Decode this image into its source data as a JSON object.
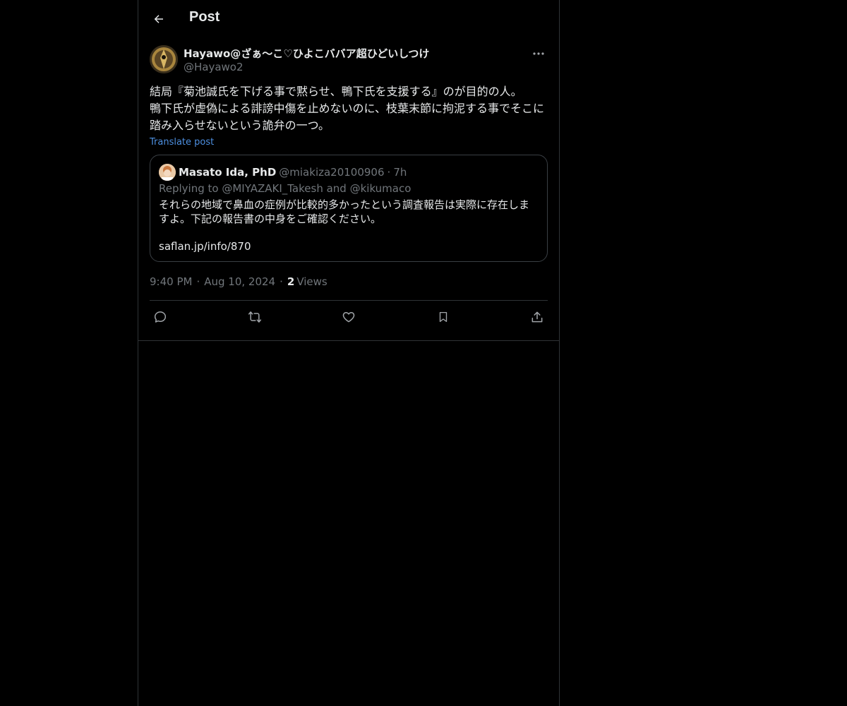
{
  "header": {
    "title": "Post"
  },
  "post": {
    "author_name": "Hayawo@ざぁ〜こ♡ひよこババア超ひどいしつけ",
    "author_handle": "@Hayawo2",
    "text": "結局『菊池誠氏を下げる事で黙らせ、鴨下氏を支援する』のが目的の人。\n鴨下氏が虚偽による誹謗中傷を止めないのに、枝葉末節に拘泥する事でそこに踏み入らせないという詭弁の一つ。",
    "translate_label": "Translate post",
    "quote": {
      "name": "Masato Ida, PhD",
      "handle": "@miakiza20100906",
      "separator": "·",
      "time": "7h",
      "replying_to": "Replying to @MIYAZAKI_Takesh and @kikumaco",
      "text": "それらの地域で鼻血の症例が比較的多かったという調査報告は実際に存在しますよ。下記の報告書の中身をご確認ください。",
      "link": "saflan.jp/info/870"
    },
    "meta": {
      "time": "9:40 PM",
      "dot": "·",
      "date": "Aug 10, 2024",
      "views_count": "2",
      "views_label": "Views"
    }
  },
  "icons": {
    "back": "arrow-left-icon",
    "more": "more-horizontal-icon",
    "reply": "reply-bubble-icon",
    "repost": "repost-icon",
    "like": "heart-icon",
    "bookmark": "bookmark-icon",
    "share": "share-upload-icon"
  },
  "colors": {
    "background": "#000000",
    "text": "#e7e9ea",
    "muted": "#71767b",
    "border": "#2f3336",
    "link": "#4d8fe0"
  }
}
